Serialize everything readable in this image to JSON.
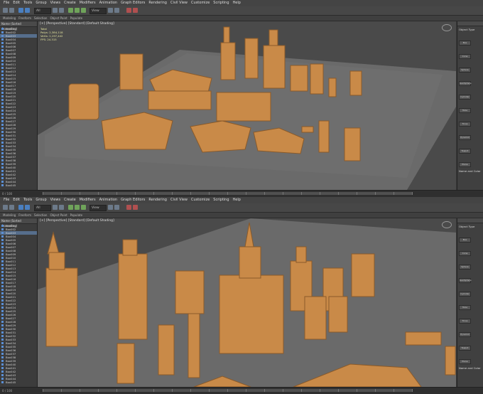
{
  "menu": [
    "File",
    "Edit",
    "Tools",
    "Group",
    "Views",
    "Create",
    "Modifiers",
    "Animation",
    "Graph Editors",
    "Rendering",
    "Civil View",
    "Customize",
    "Scripting",
    "Help"
  ],
  "toolbar": {
    "selection_set": "All",
    "view_mode": "View"
  },
  "ribbon": [
    "Modeling",
    "Freeform",
    "Selection",
    "Object Paint",
    "Populate"
  ],
  "scene_explorer": {
    "header": "Name (Sorted Ascending)",
    "top_items": [
      "Box001",
      "Box002",
      "Box003",
      "Box004",
      "Box005",
      "Box006",
      "Box007",
      "Box008",
      "Box009",
      "Box010",
      "Box011",
      "Box012",
      "Box013",
      "Box014",
      "Box015",
      "Box016",
      "Box017",
      "Box018",
      "Box019",
      "Box020",
      "Box021",
      "Box022",
      "Box023",
      "Box024",
      "Box025",
      "Box026",
      "Box027",
      "Box028",
      "Box029",
      "Box030",
      "Box031",
      "Box032",
      "Box033",
      "Box034",
      "Box035",
      "Box036",
      "Box037",
      "Box038",
      "Box039",
      "Box040",
      "Box041",
      "Box042",
      "Box043",
      "Box044",
      "Box045"
    ],
    "bottom_items": [
      "Box001",
      "Box002",
      "Box003",
      "Box004",
      "Box005",
      "Box006",
      "Box007",
      "Box008",
      "Box009",
      "Box010",
      "Box011",
      "Box012",
      "Box013",
      "Box014",
      "Box015",
      "Box016",
      "Box017",
      "Box018",
      "Box019",
      "Box020",
      "Box021",
      "Box022",
      "Box023",
      "Box024",
      "Box025",
      "Box026",
      "Box027",
      "Box028",
      "Box029",
      "Box030",
      "Box031",
      "Box032",
      "Box033",
      "Box034",
      "Box035",
      "Box036",
      "Box037",
      "Box038",
      "Box039",
      "Box040",
      "Box041",
      "Box042",
      "Box043",
      "Box044",
      "Box045"
    ]
  },
  "viewport": {
    "label": "[+] [Perspective] [Standard] [Default Shading]",
    "stats": [
      "Total",
      "Polys: 2,384,118",
      "Verts: 1,197,442",
      "FPS: 24.315"
    ]
  },
  "command_panel": {
    "header": "Object Type",
    "buttons": [
      "Box",
      "Cone",
      "Sphere",
      "GeoSphere",
      "Cylinder",
      "Tube",
      "Torus",
      "Pyramid",
      "Teapot",
      "Plane"
    ],
    "section": "Name and Color"
  },
  "status": {
    "frame": "0 / 100"
  },
  "colors": {
    "model": "#c98a48",
    "model_shadow": "#8a5a2a",
    "ground": "#6a6a6a",
    "viewport_bg": "#4a4a4a"
  }
}
